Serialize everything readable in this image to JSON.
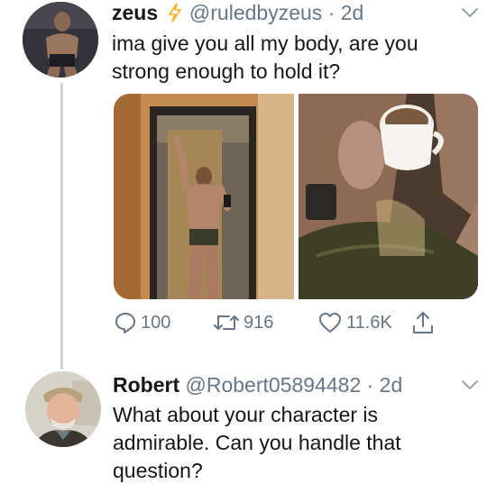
{
  "tweet": {
    "name": "zeus",
    "handle": "@ruledbyzeus",
    "time": "· 2d",
    "text": "ima give you all my body, are you strong enough to hold it?",
    "media_count": 2,
    "actions": {
      "replies": "100",
      "retweets": "916",
      "likes": "11.6K"
    }
  },
  "reply": {
    "name": "Robert",
    "handle": "@Robert05894482",
    "time": "· 2d",
    "text": "What about your character is admirable. Can you handle that question?"
  },
  "colors": {
    "text": "#14171a",
    "secondary": "#657786",
    "thread_line": "#ccd6dd",
    "bolt": "#ffad1f"
  },
  "icons": [
    "reply-icon",
    "retweet-icon",
    "like-icon",
    "share-icon",
    "chevron-down-icon",
    "lightning-bolt-icon"
  ]
}
